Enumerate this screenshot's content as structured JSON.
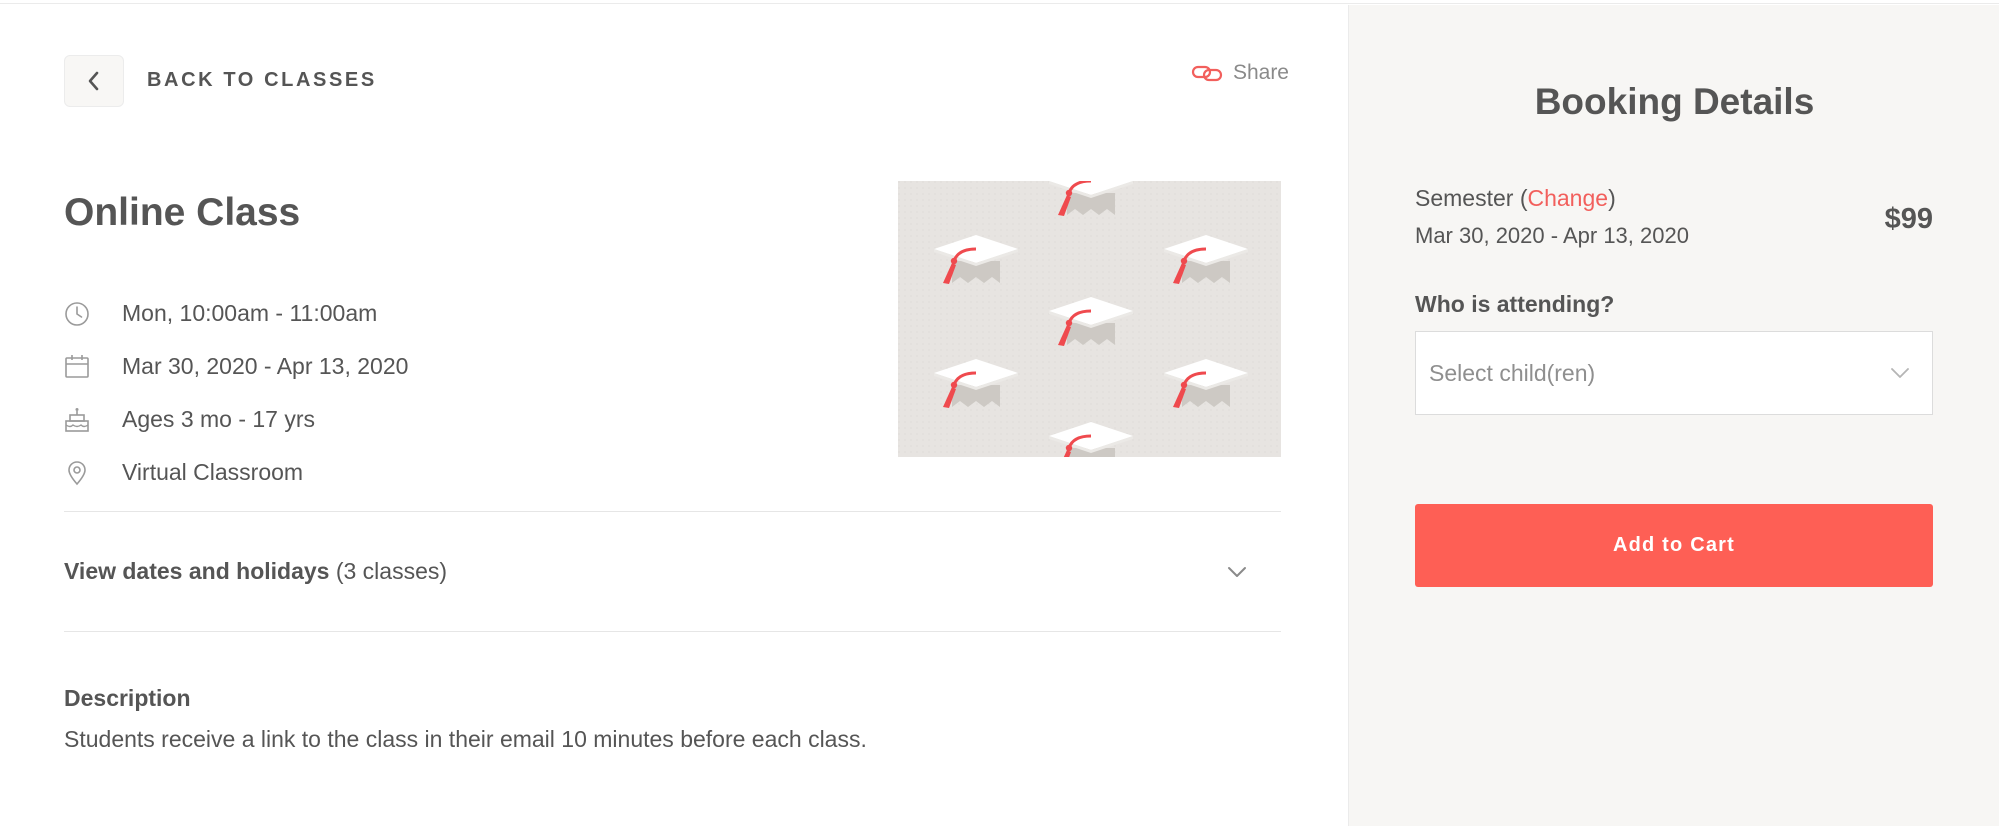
{
  "nav": {
    "back_label": "BACK TO CLASSES",
    "share_label": "Share"
  },
  "class": {
    "title": "Online Class",
    "schedule": "Mon, 10:00am - 11:00am",
    "date_range": "Mar 30, 2020 - Apr 13, 2020",
    "ages": "Ages 3 mo - 17 yrs",
    "location": "Virtual Classroom",
    "dates_toggle_bold": "View dates and holidays",
    "dates_toggle_count": "(3 classes)",
    "description_title": "Description",
    "description_body": "Students receive a link to the class in their email 10 minutes before each class."
  },
  "booking": {
    "title": "Booking Details",
    "semester_label": "Semester (",
    "change_label": "Change",
    "semester_close": ")",
    "semester_dates": "Mar 30, 2020 - Apr 13, 2020",
    "price": "$99",
    "attending_label": "Who is attending?",
    "select_placeholder": "Select child(ren)",
    "add_button": "Add to Cart"
  },
  "icons": {
    "back": "chevron-left-icon",
    "share": "link-icon",
    "schedule": "clock-icon",
    "dates": "calendar-icon",
    "ages": "cake-icon",
    "location": "location-pin-icon",
    "expand": "chevron-down-icon"
  },
  "colors": {
    "accent": "#f25f5c",
    "button": "#fe5f55",
    "text": "#555555",
    "sidebar_bg": "#f7f6f4",
    "hero_bg": "#e7e4e1"
  }
}
